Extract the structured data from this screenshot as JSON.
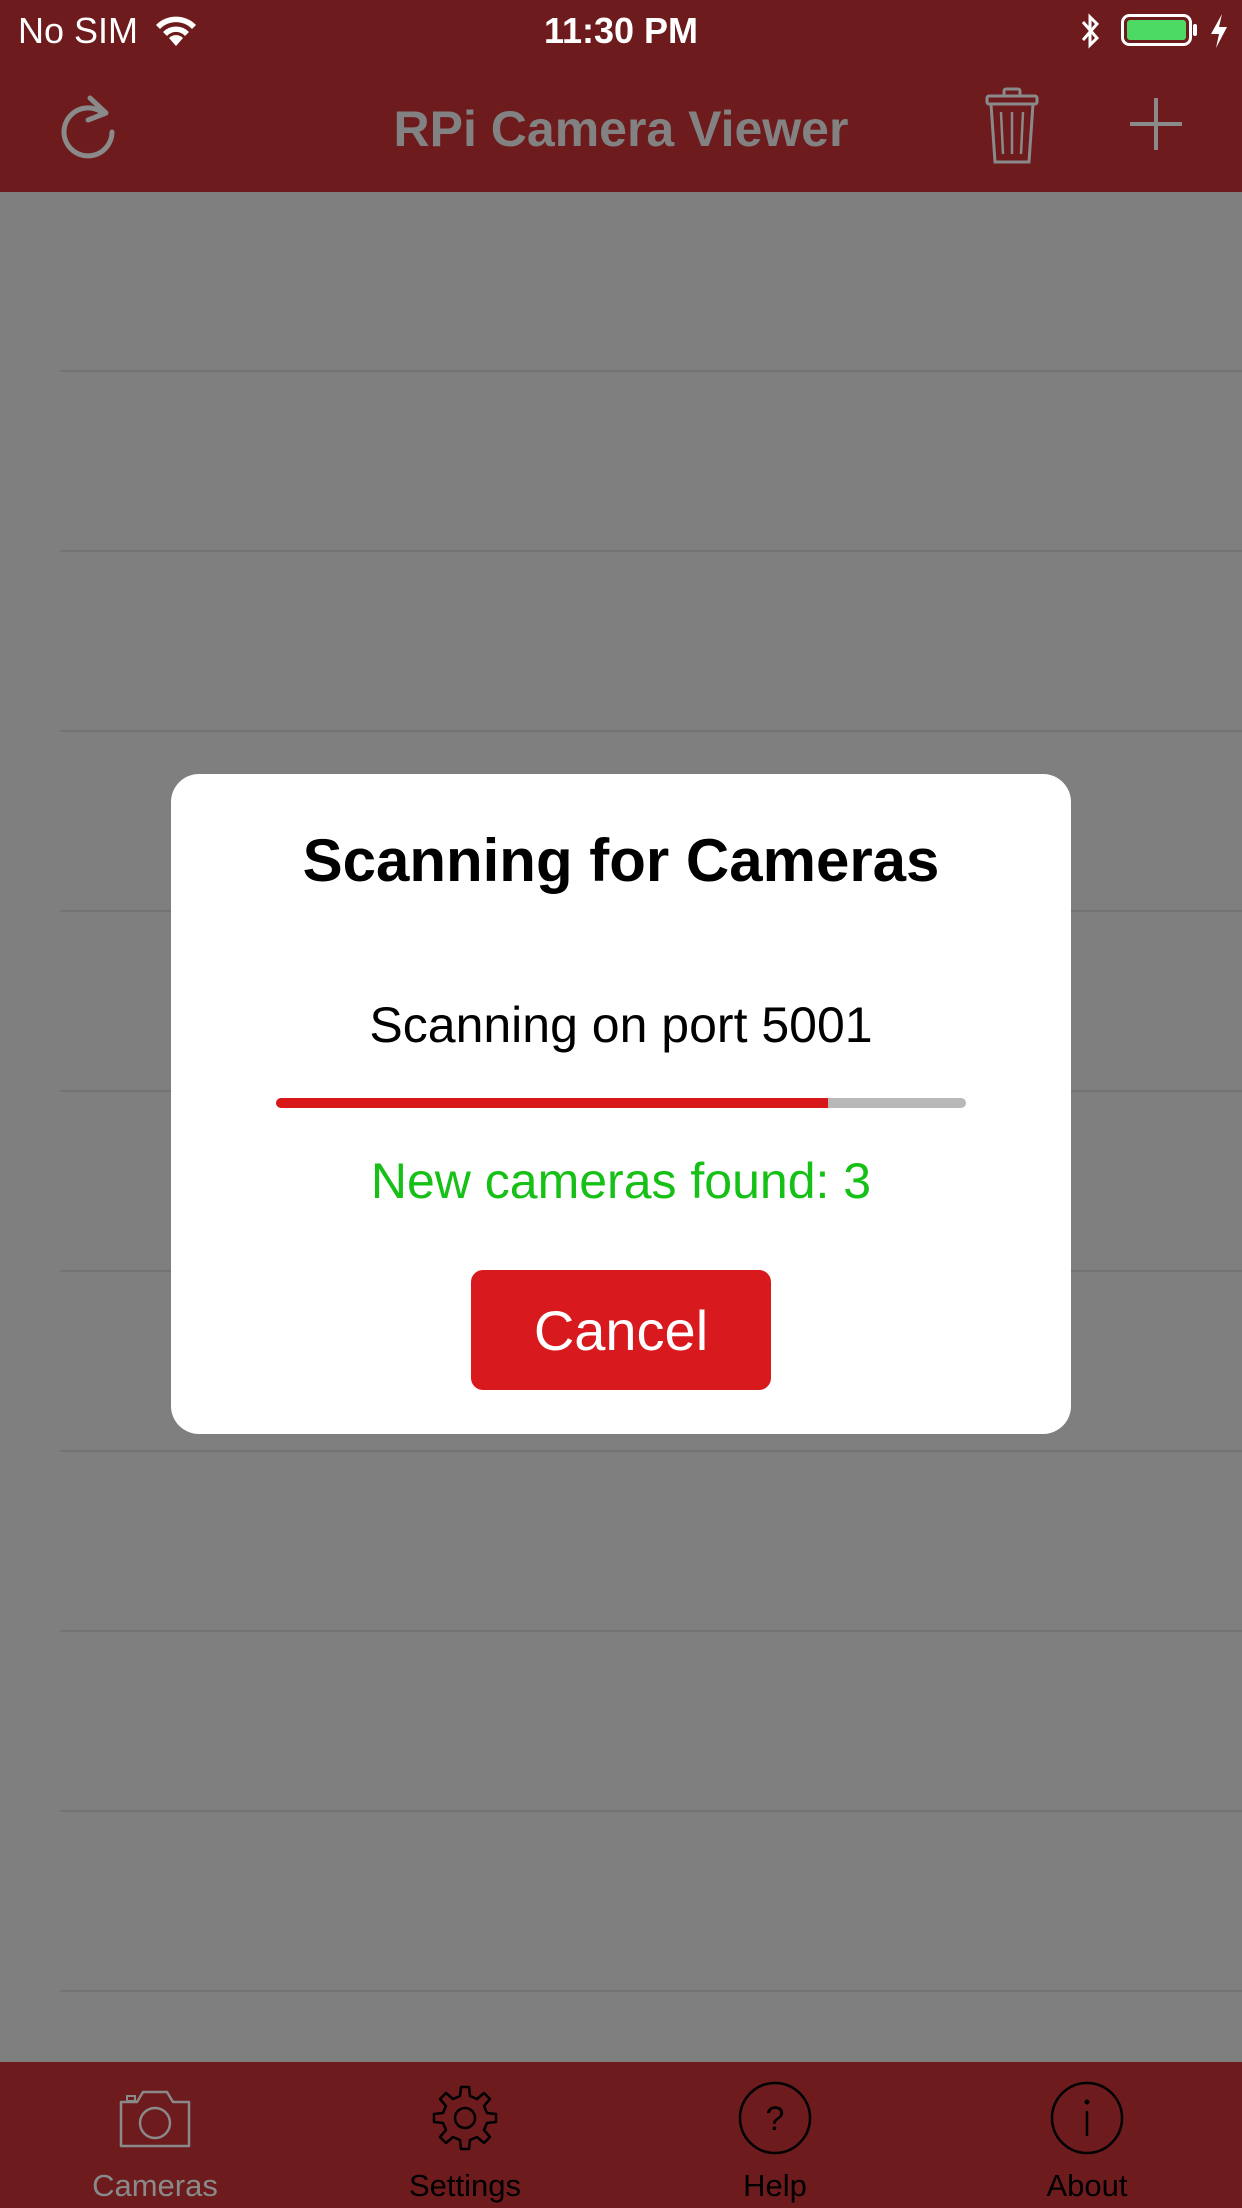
{
  "status_bar": {
    "carrier": "No SIM",
    "time": "11:30 PM",
    "battery_color": "#4cd964"
  },
  "nav": {
    "title": "RPi Camera Viewer",
    "left_icon": "refresh-icon",
    "right_icons": [
      "trash-icon",
      "add-icon"
    ]
  },
  "modal": {
    "title": "Scanning for Cameras",
    "status": "Scanning on port 5001",
    "progress": 0.8,
    "found": "New cameras found: 3",
    "cancel_label": "Cancel"
  },
  "tabs": [
    {
      "label": "Cameras",
      "icon": "camera-icon"
    },
    {
      "label": "Settings",
      "icon": "gear-icon"
    },
    {
      "label": "Help",
      "icon": "help-icon"
    },
    {
      "label": "About",
      "icon": "info-icon"
    }
  ],
  "colors": {
    "bar": "#6d1b1d",
    "accent": "#d81a1e",
    "success": "#16c016",
    "dim_overlay": "#7f7f7f"
  }
}
